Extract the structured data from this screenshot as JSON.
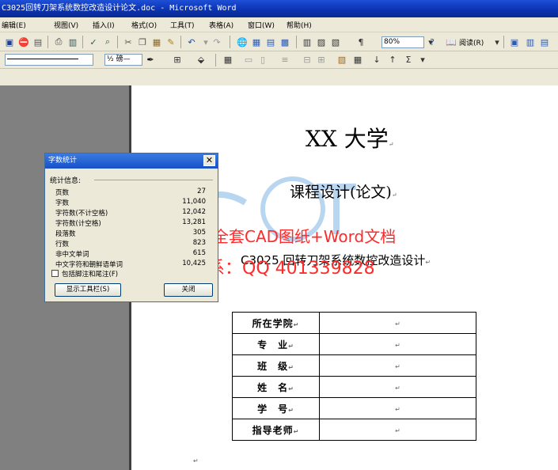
{
  "window": {
    "title": "C3025回转刀架系统数控改造设计论文.doc - Microsoft Word"
  },
  "menu": {
    "items": [
      "编辑(E)",
      "视图(V)",
      "插入(I)",
      "格式(O)",
      "工具(T)",
      "表格(A)",
      "窗口(W)",
      "帮助(H)"
    ]
  },
  "toolbar": {
    "zoom": "80%",
    "read_label": "阅读(R)",
    "char_scale": "½ 磅—",
    "sigma": "Σ"
  },
  "document": {
    "university": "XX 大学",
    "course_title": "课程设计(论文)",
    "topic": "C3025 回转刀架系统数控改造设计",
    "para_mark": "↵",
    "table": [
      {
        "label": "所在学院"
      },
      {
        "label": "专　业"
      },
      {
        "label": "班　级"
      },
      {
        "label": "姓　名"
      },
      {
        "label": "学　号"
      },
      {
        "label": "指导老师"
      }
    ]
  },
  "watermark": {
    "line1": "充值下载购买全套CAD图纸+Word文档",
    "line2": "咨询请联系：QQ 401339828"
  },
  "dialog": {
    "title": "字数统计",
    "section": "统计信息:",
    "stats": [
      {
        "label": "页数",
        "value": "27"
      },
      {
        "label": "字数",
        "value": "11,040"
      },
      {
        "label": "字符数(不计空格)",
        "value": "12,042"
      },
      {
        "label": "字符数(计空格)",
        "value": "13,281"
      },
      {
        "label": "段落数",
        "value": "305"
      },
      {
        "label": "行数",
        "value": "823"
      },
      {
        "label": "非中文单词",
        "value": "615"
      },
      {
        "label": "中文字符和朝鲜语单词",
        "value": "10,425"
      }
    ],
    "include_footnotes": "包括脚注和尾注(F)",
    "show_toolbar_btn": "显示工具栏(S)",
    "close_btn": "关闭"
  }
}
